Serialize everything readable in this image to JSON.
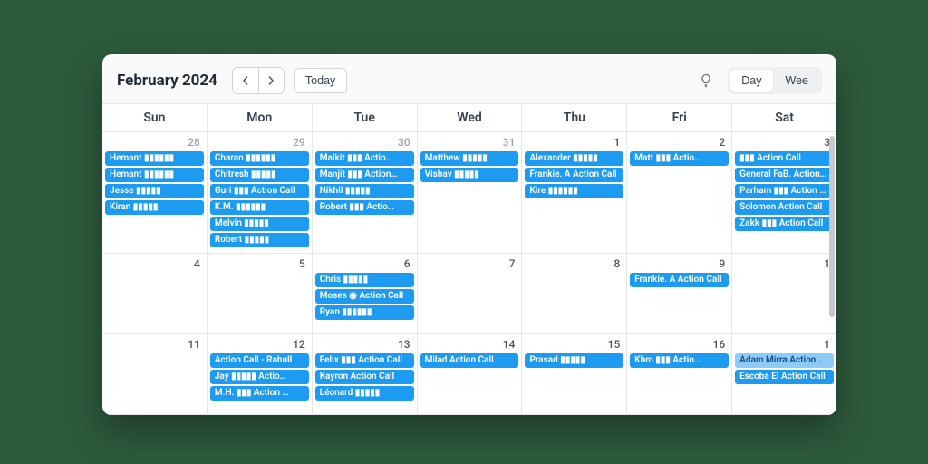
{
  "toolbar": {
    "title": "February 2024",
    "today": "Today",
    "views": {
      "day": "Day",
      "week": "Wee"
    }
  },
  "dayHeaders": [
    "Sun",
    "Mon",
    "Tue",
    "Wed",
    "Thu",
    "Fri",
    "Sat"
  ],
  "weeks": [
    {
      "days": [
        {
          "num": "28",
          "in": false,
          "events": [
            {
              "t": "Hemant ▮▮▮▮▮▮"
            },
            {
              "t": "Hemant ▮▮▮▮▮▮"
            },
            {
              "t": "Jesse ▮▮▮▮▮"
            },
            {
              "t": "Kiran ▮▮▮▮▮"
            }
          ]
        },
        {
          "num": "29",
          "in": false,
          "events": [
            {
              "t": "Charan ▮▮▮▮▮▮"
            },
            {
              "t": "Chitresh ▮▮▮▮▮"
            },
            {
              "t": "Guri ▮▮▮ Action Call"
            },
            {
              "t": "K.M. ▮▮▮▮▮▮"
            },
            {
              "t": "Melvin ▮▮▮▮▮"
            },
            {
              "t": "Robert ▮▮▮▮▮"
            }
          ]
        },
        {
          "num": "30",
          "in": false,
          "events": [
            {
              "t": "Malkit ▮▮▮ Actio…"
            },
            {
              "t": "Manjit ▮▮▮ Action…"
            },
            {
              "t": "Nikhil ▮▮▮▮▮"
            },
            {
              "t": "Robert ▮▮▮ Actio…"
            }
          ]
        },
        {
          "num": "31",
          "in": false,
          "events": [
            {
              "t": "Matthew ▮▮▮▮▮"
            },
            {
              "t": "Vishav ▮▮▮▮▮"
            }
          ]
        },
        {
          "num": "1",
          "in": true,
          "events": [
            {
              "t": "Alexander ▮▮▮▮▮"
            },
            {
              "t": "Frankie. A Action Call"
            },
            {
              "t": "Kire ▮▮▮▮▮▮"
            }
          ]
        },
        {
          "num": "2",
          "in": true,
          "events": [
            {
              "t": "Matt ▮▮▮ Actio…"
            }
          ]
        },
        {
          "num": "3",
          "in": true,
          "events": [
            {
              "t": "▮▮▮ Action Call"
            },
            {
              "t": "General FaB. Action…"
            },
            {
              "t": "Parham ▮▮▮ Action …"
            },
            {
              "t": "Solomon  Action Call"
            },
            {
              "t": "Zakk ▮▮▮ Action Call"
            }
          ]
        }
      ]
    },
    {
      "days": [
        {
          "num": "4",
          "in": true,
          "events": []
        },
        {
          "num": "5",
          "in": true,
          "events": []
        },
        {
          "num": "6",
          "in": true,
          "events": [
            {
              "t": "Chris ▮▮▮▮▮"
            },
            {
              "t": "Moses ◉  Action Call"
            },
            {
              "t": "Ryan ▮▮▮▮▮▮"
            }
          ]
        },
        {
          "num": "7",
          "in": true,
          "events": []
        },
        {
          "num": "8",
          "in": true,
          "events": []
        },
        {
          "num": "9",
          "in": true,
          "events": [
            {
              "t": "Frankie. A Action Call"
            }
          ]
        },
        {
          "num": "1",
          "in": true,
          "events": []
        }
      ]
    },
    {
      "days": [
        {
          "num": "11",
          "in": true,
          "events": []
        },
        {
          "num": "12",
          "in": true,
          "events": [
            {
              "t": "Action Call - Rahull"
            },
            {
              "t": "Jay ▮▮▮▮▮ Actio…"
            },
            {
              "t": "M.H. ▮▮▮ Action …"
            }
          ]
        },
        {
          "num": "13",
          "in": true,
          "events": [
            {
              "t": "Felix ▮▮▮ Action Call"
            },
            {
              "t": "Kayron Action Call"
            },
            {
              "t": "Léonard ▮▮▮▮▮"
            }
          ]
        },
        {
          "num": "14",
          "in": true,
          "events": [
            {
              "t": "Milad  Action Call"
            }
          ]
        },
        {
          "num": "15",
          "in": true,
          "events": [
            {
              "t": "Prasad ▮▮▮▮▮"
            }
          ]
        },
        {
          "num": "16",
          "in": true,
          "events": [
            {
              "t": "Khm ▮▮▮ Actio…"
            }
          ]
        },
        {
          "num": "1",
          "in": true,
          "events": [
            {
              "t": "Adam Mirra Action…",
              "alt": true
            },
            {
              "t": "Escoba El Action Call"
            }
          ]
        }
      ]
    }
  ]
}
